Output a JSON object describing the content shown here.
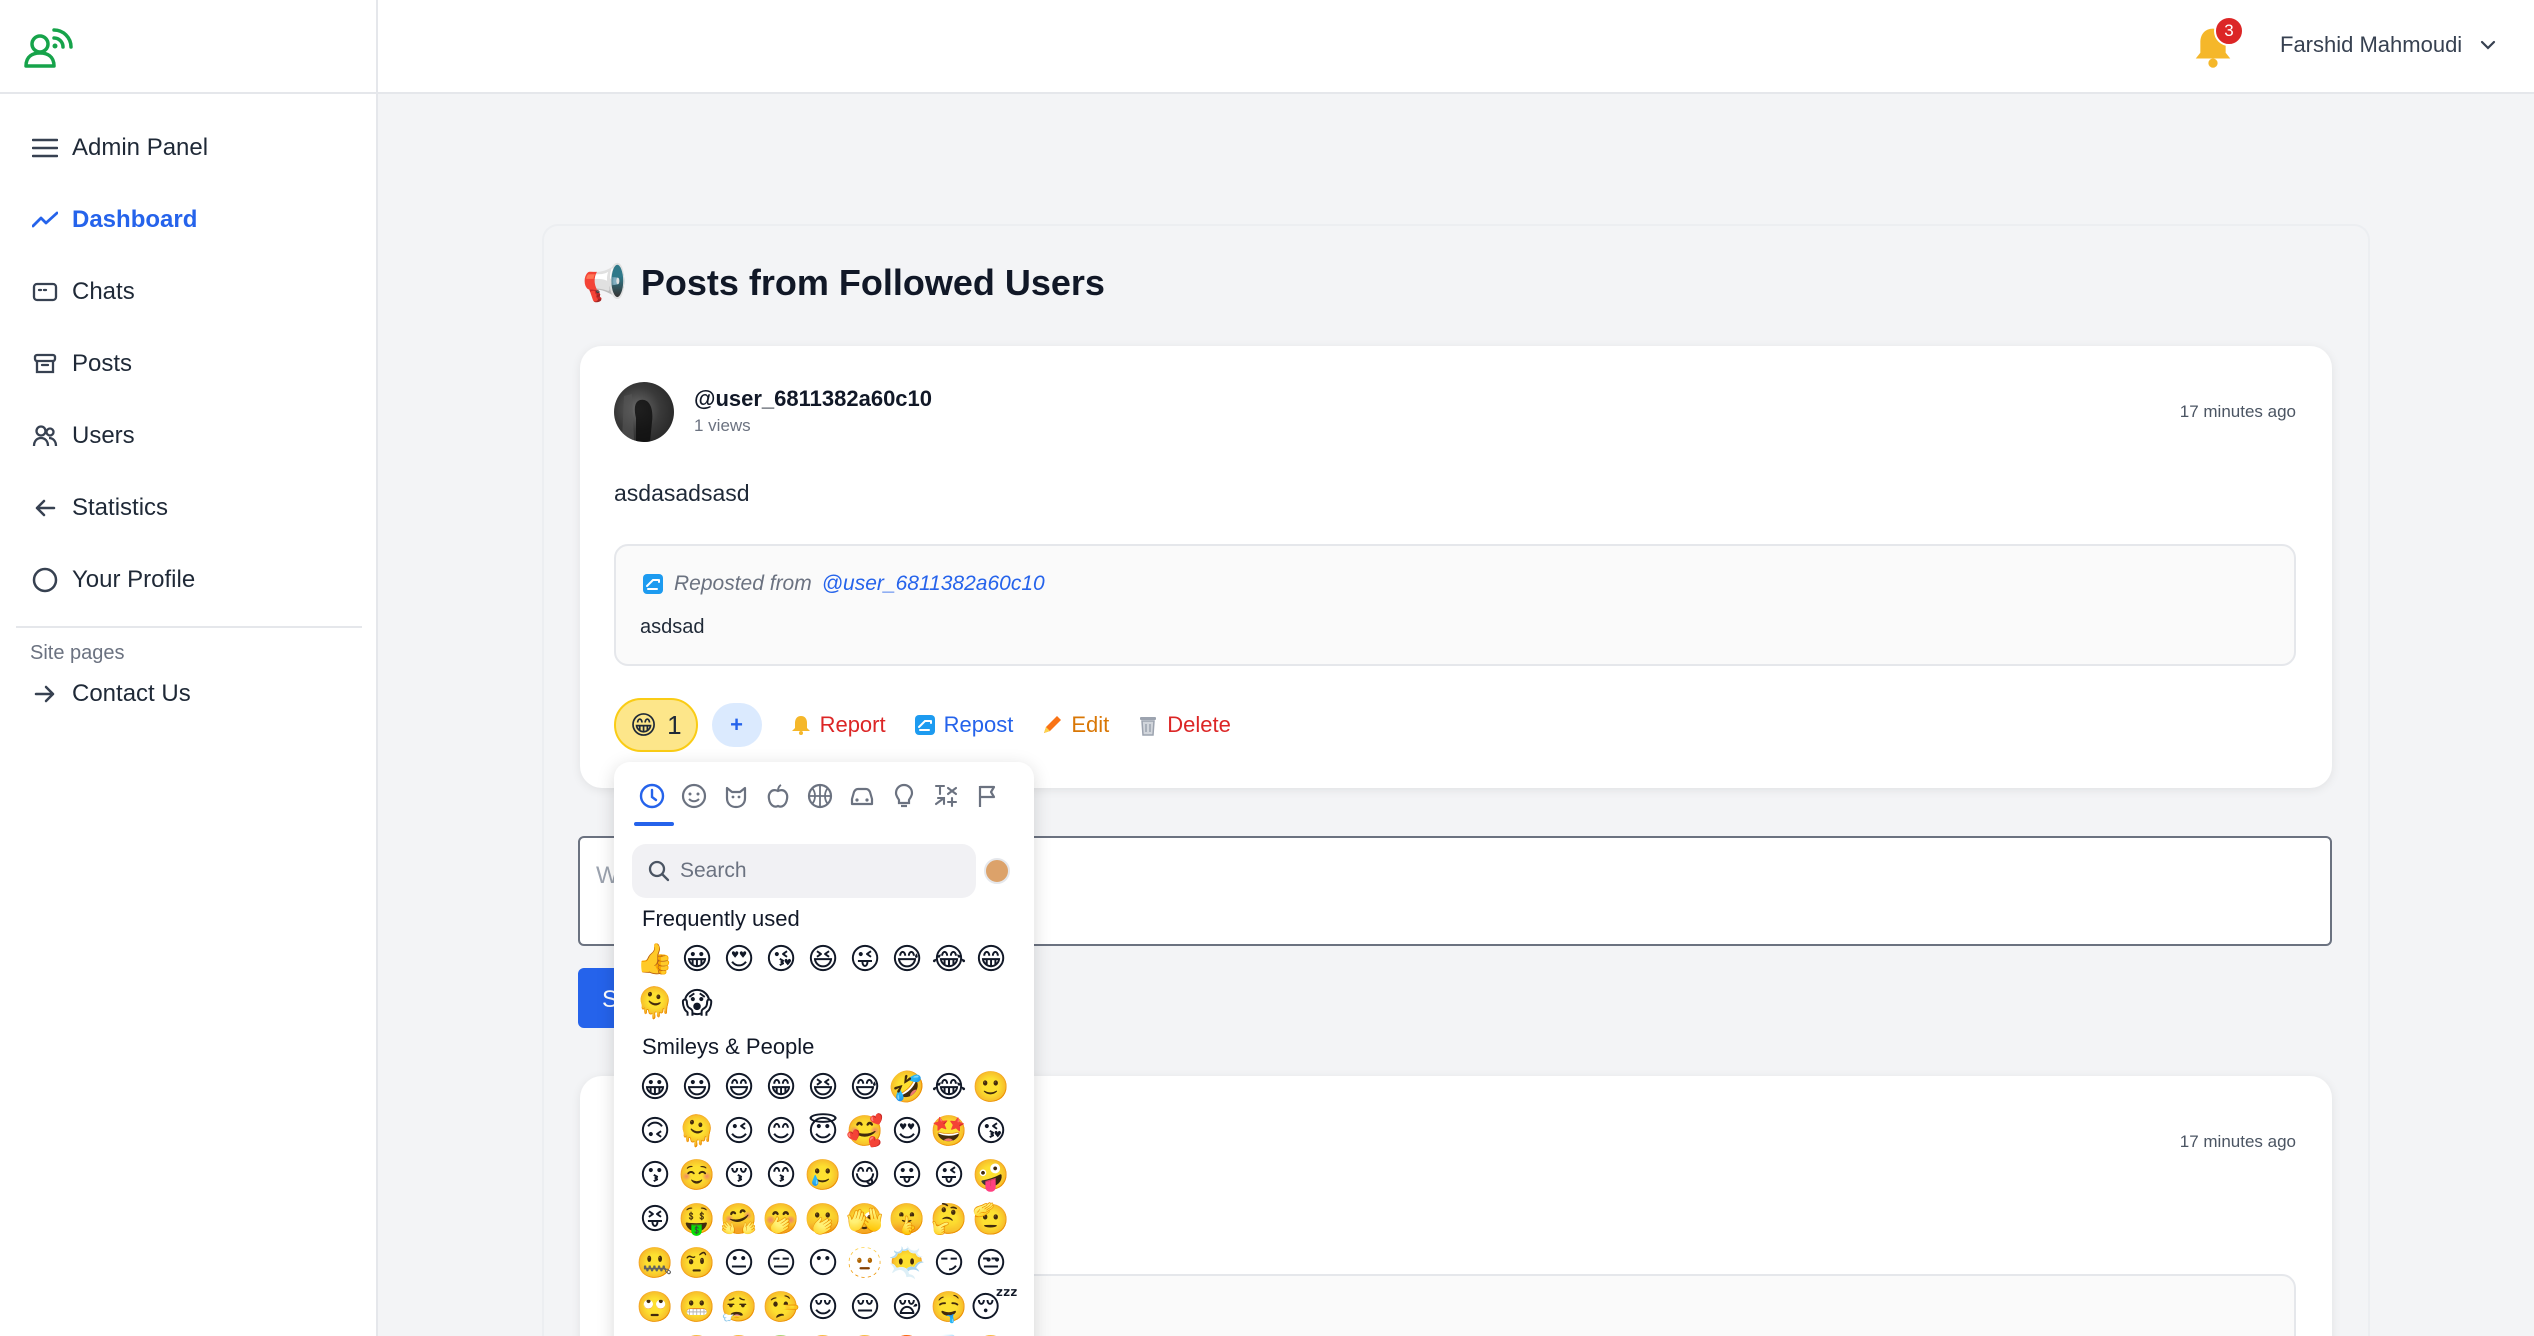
{
  "topbar": {
    "notification_count": "3",
    "user_name": "Farshid Mahmoudi"
  },
  "sidebar": {
    "items": [
      {
        "label": "Admin Panel",
        "icon": "menu-icon"
      },
      {
        "label": "Dashboard",
        "icon": "trend-icon",
        "active": true
      },
      {
        "label": "Chats",
        "icon": "chat-icon"
      },
      {
        "label": "Posts",
        "icon": "archive-icon"
      },
      {
        "label": "Users",
        "icon": "users-icon"
      },
      {
        "label": "Statistics",
        "icon": "arrow-left-icon"
      },
      {
        "label": "Your Profile",
        "icon": "circle-icon"
      }
    ],
    "site_pages_label": "Site pages",
    "contact_label": "Contact Us"
  },
  "main": {
    "section_icon": "📢",
    "section_title": "Posts from Followed Users",
    "post": {
      "author": "@user_6811382a60c10",
      "views": "1 views",
      "time": "17 minutes ago",
      "content": "asdasadsasd",
      "repost_prefix": "Reposted from",
      "repost_author": "@user_6811382a60c10",
      "repost_content": "asdsad",
      "reaction_emoji": "😁",
      "reaction_count": "1",
      "plus_label": "+",
      "report_label": "Report",
      "repost_label": "Repost",
      "edit_label": "Edit",
      "delete_label": "Delete"
    },
    "comment_placeholder": "W",
    "submit_label": "S",
    "post2_time": "17 minutes ago"
  },
  "emoji_picker": {
    "search_placeholder": "Search",
    "frequently_used_title": "Frequently used",
    "smileys_title": "Smileys & People",
    "frequently_used": [
      "👍",
      "😀",
      "😍",
      "😘",
      "😆",
      "😜",
      "😅",
      "😂",
      "😁",
      "🫠",
      "😱"
    ],
    "smileys": [
      "😀",
      "😃",
      "😄",
      "😁",
      "😆",
      "😅",
      "🤣",
      "😂",
      "🙂",
      "🙃",
      "🫠",
      "😉",
      "😊",
      "😇",
      "🥰",
      "😍",
      "🤩",
      "😘",
      "😗",
      "☺️",
      "😚",
      "😙",
      "🥲",
      "😋",
      "😛",
      "😜",
      "🤪",
      "😝",
      "🤑",
      "🤗",
      "🤭",
      "🫢",
      "🫣",
      "🤫",
      "🤔",
      "🫡",
      "🤐",
      "🤨",
      "😐",
      "😑",
      "😶",
      "🫥",
      "😶‍🌫️",
      "😏",
      "😒",
      "🙄",
      "😬",
      "😮‍💨",
      "🤥",
      "😌",
      "😔",
      "😪",
      "🤤",
      "😴",
      "😷",
      "🤒",
      "🤕",
      "🤢",
      "🤮",
      "🤧",
      "🥵",
      "🥶",
      "🥴"
    ]
  }
}
